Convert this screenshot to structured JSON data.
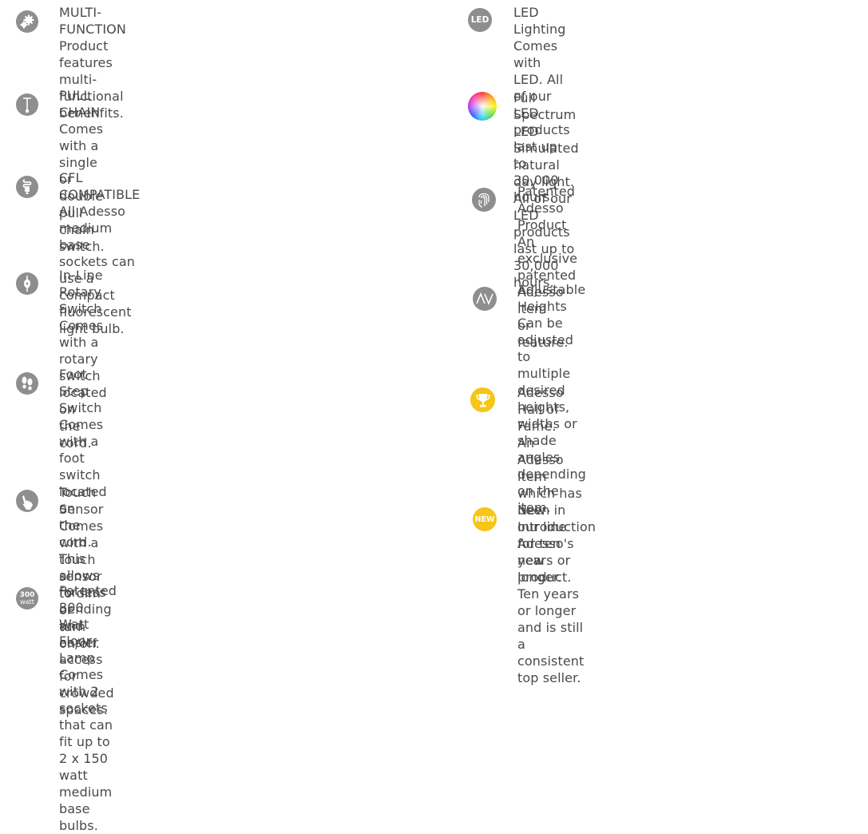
{
  "colors": {
    "icon_gray": "#8e8e8e",
    "icon_yellow": "#f5c518",
    "text": "#4a4a4a"
  },
  "left": [
    {
      "icon": "gears-icon",
      "title": "MULTI-FUNCTION",
      "desc": "Product features multi-functional benenfits."
    },
    {
      "icon": "pull-chain-icon",
      "title": "PULL CHAIN",
      "desc": "Comes with a single or double pull chain switch."
    },
    {
      "icon": "cfl-bulb-icon",
      "title": "CFL COMPATIBLE",
      "desc": "All Adesso medium base sockets can use a\ncompact fluorescent light bulb."
    },
    {
      "icon": "rotary-switch-icon",
      "title": "In-Line Rotary Switch",
      "desc": "Comes with a rotary switch located on\nthe cord."
    },
    {
      "icon": "footprints-icon",
      "title": "Foot Step Switch",
      "desc": "Comes with a foot switch located on\nthe cord. This allows for less bending and\neasier access for crowded spaces."
    },
    {
      "icon": "touch-hand-icon",
      "title": "Touch Sensor",
      "desc": "Comes with a touch sensor to dim or\nturn on/off."
    },
    {
      "icon": "300-watt-icon",
      "icon_text": "300",
      "icon_sub": "watt",
      "title": "Patented 300 Watt Floor Lamp",
      "desc": "Comes with 2 sockets that can fit up to\n2 x 150 watt medium base bulbs."
    }
  ],
  "right": [
    {
      "icon": "led-icon",
      "icon_text": "LED",
      "title": "LED Lighting",
      "desc": "Comes with LED. All of our LED products\nlast up to 30,000 hours."
    },
    {
      "icon": "color-wheel-icon",
      "title": "Full Spectrum LED",
      "desc": "Simulated natural day light. All of our LED\nproducts last up to 30,000 hours."
    },
    {
      "icon": "fingerprint-icon",
      "title": "Patented Adesso Product",
      "desc": "An exclusive patented Adesso item\nor feature."
    },
    {
      "icon": "adjustable-heights-icon",
      "title": "Adjustable Heights",
      "desc": "Can be adjusted to multiple desired heights,\nwidths or shade angles depending on the item."
    },
    {
      "icon": "trophy-icon",
      "title": "Adesso Hall of Fame.",
      "desc": "An Adesso item which has been in our line\nfor ten years or longer. Ten years or longer\nand is still a consistent top seller."
    },
    {
      "icon": "new-badge-icon",
      "icon_text": "NEW",
      "title": "New Introduction",
      "desc": "Adesso's new product."
    }
  ]
}
